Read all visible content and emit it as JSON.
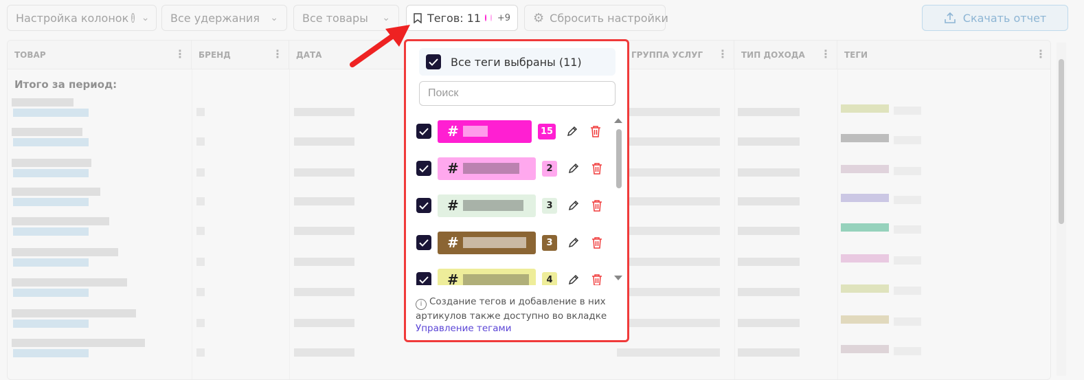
{
  "toolbar": {
    "columns_label": "Настройка колонок",
    "deductions_label": "Все удержания",
    "products_label": "Все товары",
    "tags_label": "Тегов: 11",
    "tags_more": "+9",
    "reset_label": "Сбросить настройки",
    "download_label": "Скачать отчет"
  },
  "table": {
    "headers": [
      "ТОВАР",
      "БРЕНД",
      "ДАТА",
      "",
      "ГРУППА УСЛУГ",
      "ТИП ДОХОДА",
      "ТЕГИ"
    ],
    "total_label": "Итого за период:"
  },
  "popup": {
    "all_label": "Все теги выбраны (11)",
    "search_placeholder": "Поиск",
    "tags": [
      {
        "prefix": "#",
        "count": "15",
        "color": "#ff1fd2",
        "text_color": "#ffffff",
        "count_bg": "#ff1fd2",
        "count_color": "#ffffff"
      },
      {
        "prefix": "#",
        "count": "2",
        "color": "#ffa8ee",
        "text_color": "#222222",
        "count_bg": "#ffa8ee",
        "count_color": "#222222"
      },
      {
        "prefix": "#",
        "count": "3",
        "color": "#e2f1e2",
        "text_color": "#222222",
        "count_bg": "#e2f1e2",
        "count_color": "#222222"
      },
      {
        "prefix": "#",
        "count": "3",
        "color": "#8b6533",
        "text_color": "#ffffff",
        "count_bg": "#8b6533",
        "count_color": "#ffffff"
      },
      {
        "prefix": "#",
        "count": "4",
        "color": "#eeed9a",
        "text_color": "#222222",
        "count_bg": "#eeed9a",
        "count_color": "#222222"
      }
    ],
    "info_text": "Создание тегов и добавление в них артикулов также доступно во вкладке",
    "info_link": "Управление тегами"
  },
  "colors": {
    "accent": "#2b7bb9",
    "highlight": "#f03a3a",
    "checkbox": "#1a1536",
    "link": "#5b45d6"
  }
}
